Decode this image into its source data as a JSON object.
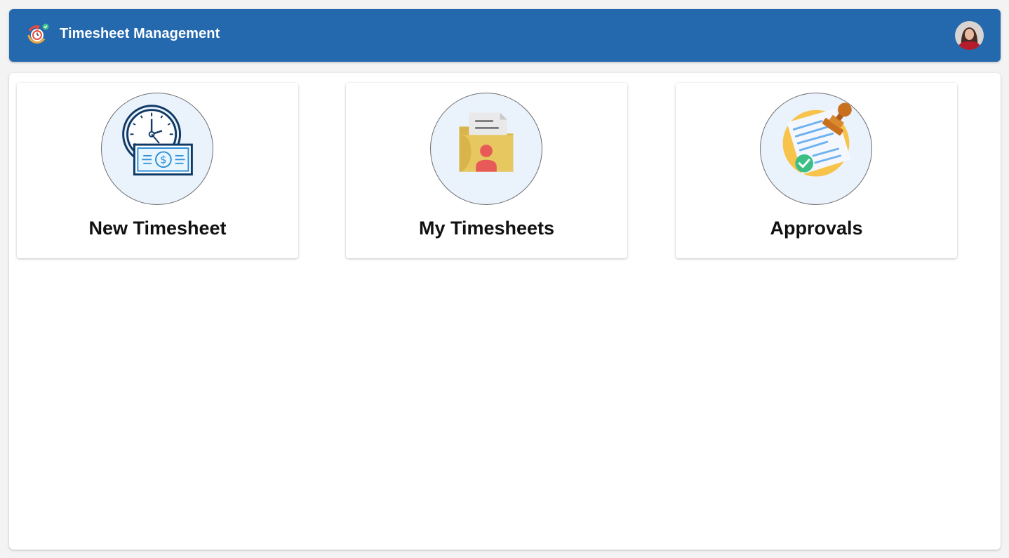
{
  "header": {
    "app_title": "Timesheet Management",
    "logo_icon": "stopwatch-check-icon",
    "avatar_icon": "user-avatar",
    "background_color": "#2468ae"
  },
  "tiles": [
    {
      "label": "New Timesheet",
      "icon": "clock-money-icon"
    },
    {
      "label": "My Timesheets",
      "icon": "user-folder-icon"
    },
    {
      "label": "Approvals",
      "icon": "approval-stamp-icon"
    }
  ]
}
